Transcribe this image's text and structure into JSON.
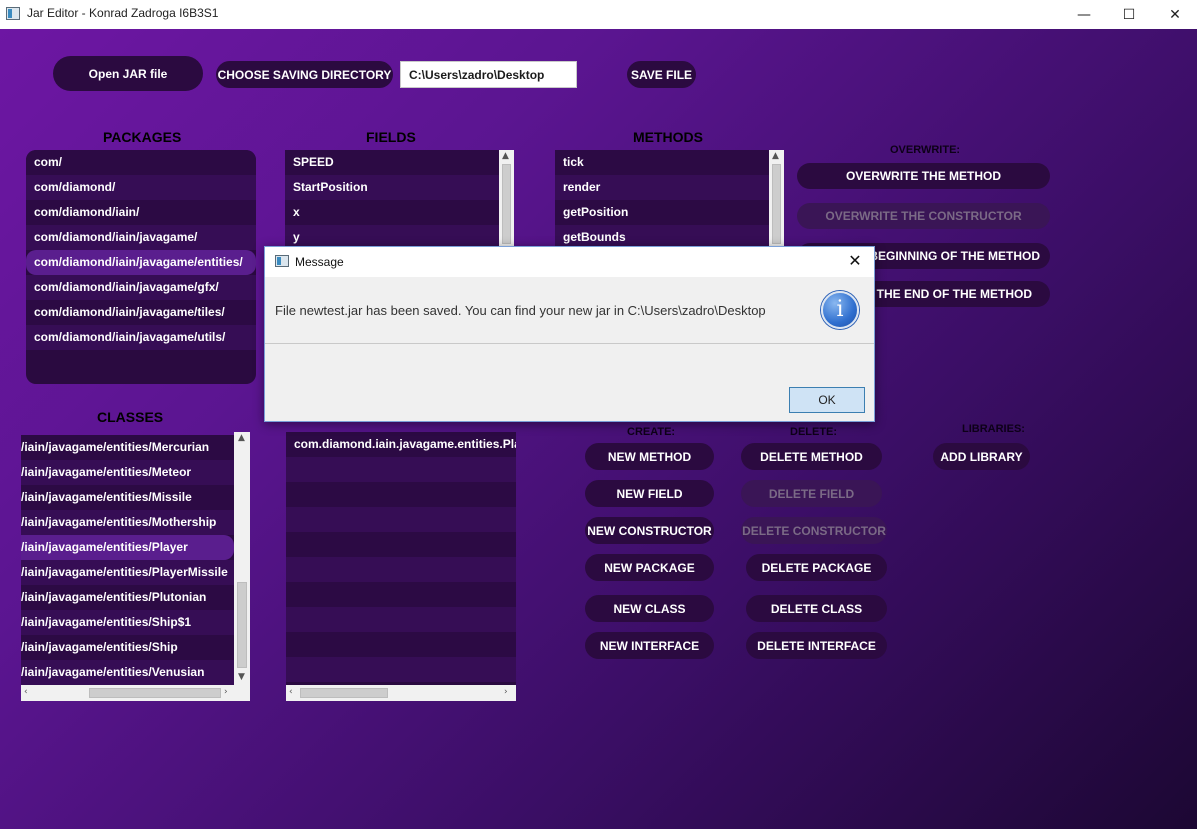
{
  "window": {
    "title": "Jar Editor - Konrad Zadroga I6B3S1",
    "minimize": "—",
    "maximize": "☐",
    "close": "✕"
  },
  "toolbar": {
    "open_jar": "Open JAR file",
    "choose_dir": "CHOOSE SAVING DIRECTORY",
    "path_value": "C:\\Users\\zadro\\Desktop",
    "save_file": "SAVE FILE"
  },
  "packages": {
    "heading": "PACKAGES",
    "items": [
      "com/",
      "com/diamond/",
      "com/diamond/iain/",
      "com/diamond/iain/javagame/",
      "com/diamond/iain/javagame/entities/",
      "com/diamond/iain/javagame/gfx/",
      "com/diamond/iain/javagame/tiles/",
      "com/diamond/iain/javagame/utils/"
    ],
    "selected_index": 4
  },
  "fields": {
    "heading": "FIELDS",
    "items": [
      "SPEED",
      "StartPosition",
      "x",
      "y"
    ]
  },
  "methods": {
    "heading": "METHODS",
    "items": [
      "tick",
      "render",
      "getPosition",
      "getBounds"
    ]
  },
  "overwrite": {
    "heading": "OVERWRITE:",
    "method": "OVERWRITE THE METHOD",
    "constructor": "OVERWRITE THE CONSTRUCTOR",
    "beginning": "T BEGINNING OF THE METHOD",
    "end": "AT THE END OF THE METHOD"
  },
  "classes": {
    "heading": "CLASSES",
    "items": [
      "/iain/javagame/entities/Mercurian",
      "/iain/javagame/entities/Meteor",
      "/iain/javagame/entities/Missile",
      "/iain/javagame/entities/Mothership",
      "/iain/javagame/entities/Player",
      "/iain/javagame/entities/PlayerMissile",
      "/iain/javagame/entities/Plutonian",
      "/iain/javagame/entities/Ship$1",
      "/iain/javagame/entities/Ship",
      "/iain/javagame/entities/Venusian"
    ],
    "selected_index": 4
  },
  "class_detail": {
    "items": [
      "com.diamond.iain.javagame.entities.Player",
      "",
      "",
      "",
      "",
      "",
      "",
      "",
      "",
      ""
    ]
  },
  "create": {
    "heading": "CREATE:",
    "new_method": "NEW METHOD",
    "new_field": "NEW FIELD",
    "new_constructor": "NEW CONSTRUCTOR",
    "new_package": "NEW PACKAGE",
    "new_class": "NEW CLASS",
    "new_interface": "NEW INTERFACE"
  },
  "delete": {
    "heading": "DELETE:",
    "delete_method": "DELETE METHOD",
    "delete_field": "DELETE FIELD",
    "delete_constructor": "DELETE CONSTRUCTOR",
    "delete_package": "DELETE PACKAGE",
    "delete_class": "DELETE CLASS",
    "delete_interface": "DELETE INTERFACE"
  },
  "libraries": {
    "heading": "LIBRARIES:",
    "add_library": "ADD LIBRARY"
  },
  "dialog": {
    "title": "Message",
    "close": "✕",
    "message": "File newtest.jar has been saved. You can find your new jar in C:\\Users\\zadro\\Desktop",
    "icon_glyph": "i",
    "ok": "OK"
  }
}
